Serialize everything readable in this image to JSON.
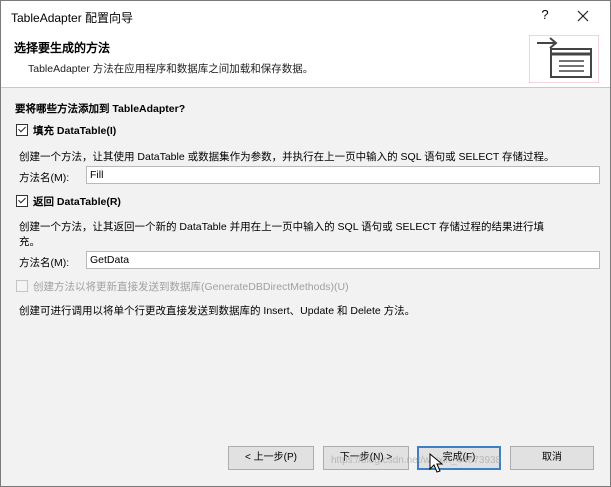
{
  "window": {
    "title": "TableAdapter 配置向导",
    "help_label": "?"
  },
  "header": {
    "title": "选择要生成的方法",
    "subtitle": "TableAdapter 方法在应用程序和数据库之间加载和保存数据。",
    "icon": "wizard-table-icon"
  },
  "form": {
    "question": "要将哪些方法添加到 TableAdapter?",
    "fill": {
      "checked": true,
      "label": "填充 DataTable(I)",
      "description": "创建一个方法，让其使用 DataTable 或数据集作为参数，并执行在上一页中输入的 SQL 语句或 SELECT 存储过程。",
      "name_label": "方法名(M):",
      "name_value": "Fill"
    },
    "return": {
      "checked": true,
      "label": "返回 DataTable(R)",
      "description_line1": "创建一个方法，让其返回一个新的 DataTable 并用在上一页中输入的 SQL 语句或 SELECT 存储过程的结果进行填",
      "description_line2": "充。",
      "name_label": "方法名(M):",
      "name_value": "GetData"
    },
    "direct": {
      "checked": false,
      "enabled": false,
      "label": "创建方法以将更新直接发送到数据库(GenerateDBDirectMethods)(U)",
      "description": "创建可进行调用以将单个行更改直接发送到数据库的 Insert、Update 和 Delete 方法。"
    }
  },
  "buttons": {
    "prev": "< 上一步(P)",
    "next": "下一步(N) >",
    "finish": "完成(F)",
    "cancel": "取消"
  },
  "watermark": "https://blog.csdn.net/weixin_44673938",
  "colors": {
    "body_bg": "#f2f2f2",
    "default_button_border": "#3c7fc4"
  }
}
